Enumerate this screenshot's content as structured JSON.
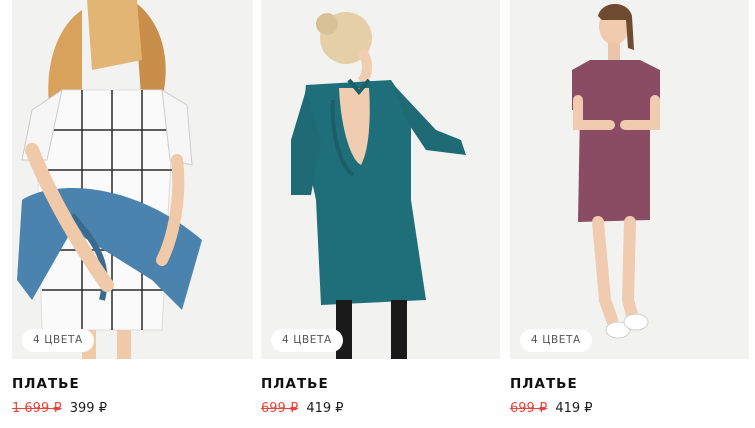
{
  "products": [
    {
      "name": "ПЛАТЬЕ",
      "old_price": "1 699 ₽",
      "new_price": "399 ₽",
      "colors_badge": "4 ЦВЕТА"
    },
    {
      "name": "ПЛАТЬЕ",
      "old_price": "699 ₽",
      "new_price": "419 ₽",
      "colors_badge": "4 ЦВЕТА"
    },
    {
      "name": "ПЛАТЬЕ",
      "old_price": "699 ₽",
      "new_price": "419 ₽",
      "colors_badge": "4 ЦВЕТА"
    }
  ],
  "colors": {
    "old_price": "#e8443a",
    "photo_background": "#f1f1f0"
  }
}
